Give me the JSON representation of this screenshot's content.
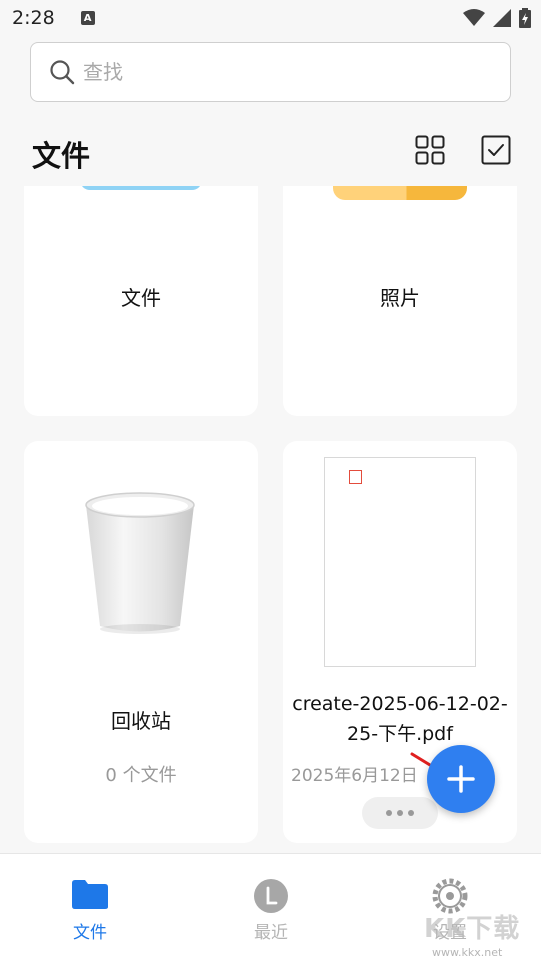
{
  "status_bar": {
    "time": "2:28"
  },
  "search": {
    "placeholder": "查找"
  },
  "header": {
    "title": "文件"
  },
  "folders": [
    {
      "label": "文件"
    },
    {
      "label": "照片"
    }
  ],
  "trash": {
    "label": "回收站",
    "count_text": "0 个文件"
  },
  "pdf_file": {
    "name": "create-2025-06-12-02-25-下午.pdf",
    "date": "2025年6月12日"
  },
  "bottom_nav": {
    "items": [
      {
        "label": "文件",
        "active": true
      },
      {
        "label": "最近",
        "active": false
      },
      {
        "label": "设置",
        "active": false
      }
    ]
  },
  "watermark": {
    "text": "KK下载",
    "url": "www.kkx.net"
  },
  "colors": {
    "accent": "#2f7ff0",
    "folder_blue": "#1e78e8",
    "folder_yellow": "#f6b73c"
  }
}
